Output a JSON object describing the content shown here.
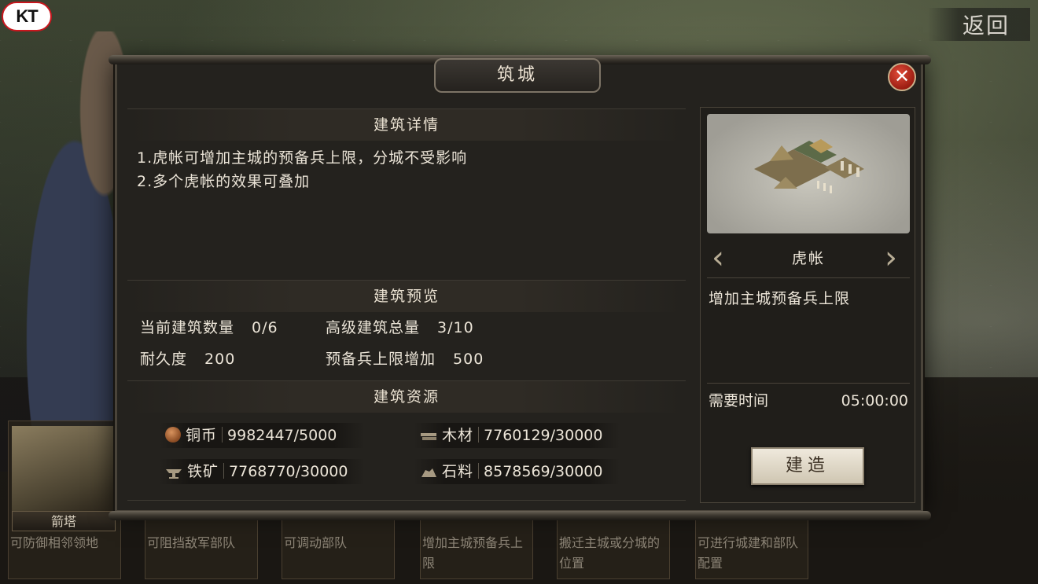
{
  "logo": {
    "text": "KT"
  },
  "back_button": {
    "label": "返回"
  },
  "background_buildings": [
    {
      "name": "箭塔",
      "desc": "可防御相邻领地"
    },
    {
      "name": "",
      "desc": "可阻挡敌军部队"
    },
    {
      "name": "",
      "desc": "可调动部队"
    },
    {
      "name": "",
      "desc": "增加主城预备兵上限"
    },
    {
      "name": "",
      "desc": "搬迁主城或分城的位置"
    },
    {
      "name": "",
      "desc": "可进行城建和部队配置"
    }
  ],
  "dialog": {
    "title": "筑城",
    "details": {
      "heading": "建筑详情",
      "lines": [
        "1.虎帐可增加主城的预备兵上限，分城不受影响",
        "2.多个虎帐的效果可叠加"
      ]
    },
    "preview_section": {
      "heading": "建筑预览",
      "stats": [
        {
          "label": "当前建筑数量",
          "value": "0/6"
        },
        {
          "label": "高级建筑总量",
          "value": "3/10"
        },
        {
          "label": "耐久度",
          "value": "200"
        },
        {
          "label": "预备兵上限增加",
          "value": "500"
        }
      ]
    },
    "resources_section": {
      "heading": "建筑资源",
      "items": [
        {
          "icon": "copper-coin-icon",
          "label": "铜币",
          "value": "9982447/5000"
        },
        {
          "icon": "wood-icon",
          "label": "木材",
          "value": "7760129/30000"
        },
        {
          "icon": "iron-ore-icon",
          "label": "铁矿",
          "value": "7768770/30000"
        },
        {
          "icon": "stone-icon",
          "label": "石料",
          "value": "8578569/30000"
        }
      ]
    },
    "building": {
      "name": "虎帐",
      "description": "增加主城预备兵上限",
      "time_label": "需要时间",
      "time_value": "05:00:00",
      "build_label": "建造"
    }
  },
  "colors": {
    "accent_close": "#c0291b",
    "panel_bg": "#24221e",
    "text": "#ece5d8"
  }
}
